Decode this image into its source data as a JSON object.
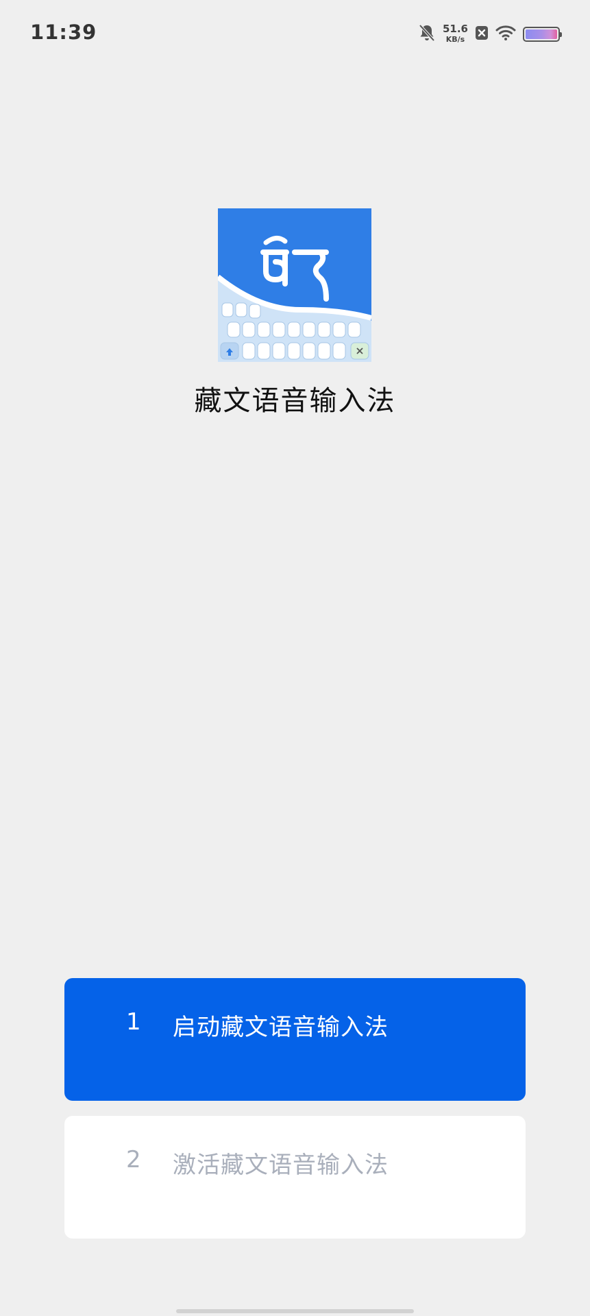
{
  "status_bar": {
    "time": "11:39",
    "net_speed_value": "51.6",
    "net_speed_unit": "KB/s",
    "icons": [
      "bell-muted-icon",
      "close-box-icon",
      "wifi-icon",
      "battery-icon"
    ]
  },
  "app": {
    "name": "藏文语音输入法",
    "logo_glyph": "ཚོད",
    "logo_colors": {
      "top": "#2f7ee6",
      "keyboard": "#cfe3f7"
    }
  },
  "steps": [
    {
      "number": "1",
      "label": "启动藏文语音输入法",
      "state": "active",
      "bg": "#0562e8"
    },
    {
      "number": "2",
      "label": "激活藏文语音输入法",
      "state": "inactive",
      "bg": "#ffffff"
    }
  ],
  "colors": {
    "background": "#efefef",
    "accent": "#0562e8",
    "inactive_text": "#a9afbb"
  }
}
